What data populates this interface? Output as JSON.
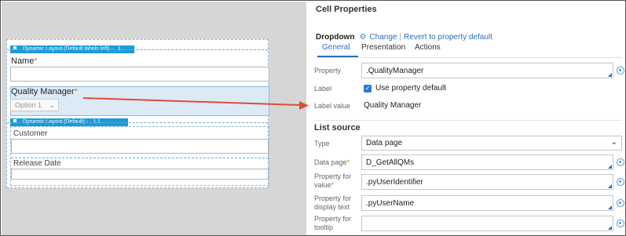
{
  "designer": {
    "outer_layout": {
      "title": "Dynamic Layout (Default labels left) -",
      "number": "1"
    },
    "name_field": {
      "label": "Name",
      "required": "*"
    },
    "qm_field": {
      "label": "Quality Manager",
      "required": "*",
      "select_value": "Option 1",
      "chevron": "⌄"
    },
    "inner_layout": {
      "title": "Dynamic Layout (Default) -",
      "number": "1.1"
    },
    "customer_label": "Customer",
    "release_date_label": "Release Date"
  },
  "panel": {
    "title": "Cell Properties",
    "control_name": "Dropdown",
    "change_link": "Change",
    "separator": "|",
    "revert_link": "Revert to property default",
    "tabs": [
      "General",
      "Presentation",
      "Actions"
    ],
    "property": {
      "label": "Property",
      "value": ".QualityManager"
    },
    "label_row": {
      "label": "Label",
      "checkbox_text": "Use property default"
    },
    "label_value": {
      "label": "Label value",
      "value": "Quality Manager"
    },
    "list_source_title": "List source",
    "type": {
      "label": "Type",
      "value": "Data page"
    },
    "data_page": {
      "label": "Data page",
      "required": "*",
      "value": "D_GetAllQMs"
    },
    "prop_value": {
      "label_line1": "Property for",
      "label_line2": "value",
      "required": "*",
      "value": ".pyUserIdentifier"
    },
    "prop_display": {
      "label_line1": "Property for",
      "label_line2": "display text",
      "value": ".pyUserName"
    },
    "prop_tooltip": {
      "label_line1": "Property for",
      "label_line2": "tooltip",
      "value": ""
    }
  },
  "colors": {
    "layout_header": "#1a9bd7",
    "link": "#2b6fb8",
    "required": "#e07b00",
    "arrow": "#e04b3a"
  }
}
